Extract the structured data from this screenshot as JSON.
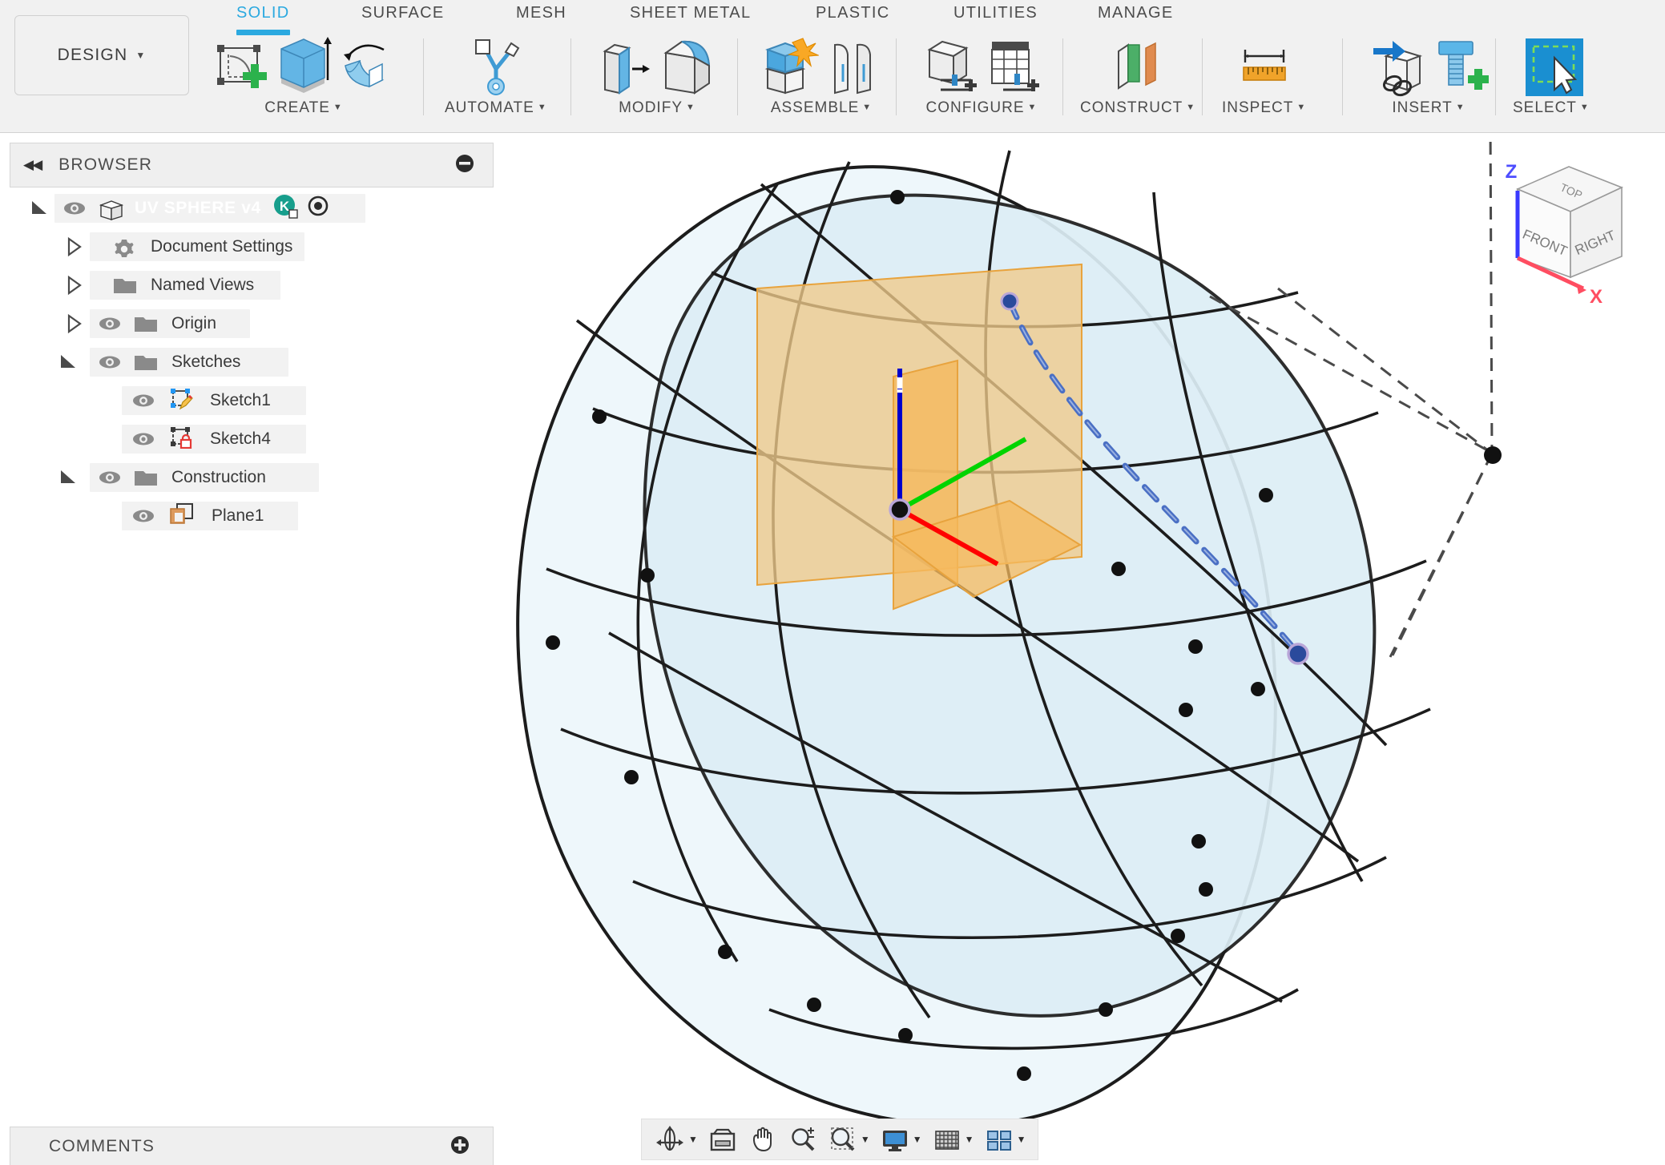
{
  "app": {
    "workspace": "DESIGN",
    "workspace_caret": "▼"
  },
  "ribbon": {
    "tabs": [
      {
        "label": "SOLID",
        "active": true
      },
      {
        "label": "SURFACE",
        "active": false
      },
      {
        "label": "MESH",
        "active": false
      },
      {
        "label": "SHEET METAL",
        "active": false
      },
      {
        "label": "PLASTIC",
        "active": false
      },
      {
        "label": "UTILITIES",
        "active": false
      },
      {
        "label": "MANAGE",
        "active": false
      }
    ],
    "panels": [
      {
        "label": "CREATE",
        "caret": "▼",
        "icons": [
          "create-sketch-icon",
          "extrude-icon",
          "revolve-icon"
        ]
      },
      {
        "label": "AUTOMATE",
        "caret": "▼",
        "icons": [
          "automate-icon"
        ]
      },
      {
        "label": "MODIFY",
        "caret": "▼",
        "icons": [
          "press-pull-icon",
          "fillet-icon"
        ]
      },
      {
        "label": "ASSEMBLE",
        "caret": "▼",
        "icons": [
          "new-component-icon",
          "joint-icon"
        ]
      },
      {
        "label": "CONFIGURE",
        "caret": "▼",
        "icons": [
          "configure-body-icon",
          "configure-table-icon"
        ]
      },
      {
        "label": "CONSTRUCT",
        "caret": "▼",
        "icons": [
          "offset-plane-icon"
        ]
      },
      {
        "label": "INSPECT",
        "caret": "▼",
        "icons": [
          "measure-icon"
        ]
      },
      {
        "label": "INSERT",
        "caret": "▼",
        "icons": [
          "insert-derive-icon",
          "insert-mcmaster-icon"
        ]
      },
      {
        "label": "SELECT",
        "caret": "▼",
        "icons": [
          "select-window-icon"
        ]
      }
    ]
  },
  "browser": {
    "title": "BROWSER",
    "collapse_icon": "collapse-left-icon",
    "minimize_icon": "minus-circle-icon",
    "tree": [
      {
        "label": "UV SPHERE v4",
        "indent": 0,
        "arrow": "expanded",
        "eye": true,
        "icon": "component-cube-icon",
        "selected": true,
        "badge": "K",
        "target": true
      },
      {
        "label": "Document Settings",
        "indent": 1,
        "arrow": "collapsed",
        "eye": false,
        "icon": "gear-icon"
      },
      {
        "label": "Named Views",
        "indent": 1,
        "arrow": "collapsed",
        "eye": false,
        "icon": "folder-icon"
      },
      {
        "label": "Origin",
        "indent": 1,
        "arrow": "collapsed",
        "eye": true,
        "icon": "folder-icon"
      },
      {
        "label": "Sketches",
        "indent": 1,
        "arrow": "expanded",
        "eye": true,
        "icon": "folder-icon"
      },
      {
        "label": "Sketch1",
        "indent": 2,
        "arrow": "none",
        "eye": true,
        "icon": "sketch-pencil-icon"
      },
      {
        "label": "Sketch4",
        "indent": 2,
        "arrow": "none",
        "eye": true,
        "icon": "sketch-locked-icon"
      },
      {
        "label": "Construction",
        "indent": 1,
        "arrow": "expanded",
        "eye": true,
        "icon": "folder-icon"
      },
      {
        "label": "Plane1",
        "indent": 2,
        "arrow": "none",
        "eye": true,
        "icon": "plane-icon"
      }
    ]
  },
  "comments": {
    "title": "COMMENTS",
    "add_icon": "plus-circle-icon"
  },
  "viewcube": {
    "faces": {
      "top": "TOP",
      "front": "FRONT",
      "right": "RIGHT"
    },
    "axes": {
      "z": "Z",
      "x": "X"
    },
    "z_color": "#3333ff",
    "x_color": "#ff3344"
  },
  "navbar": {
    "items": [
      {
        "name": "orbit-icon",
        "caret": true
      },
      {
        "name": "pan-view-icon",
        "caret": false
      },
      {
        "name": "pan-hand-icon",
        "caret": false
      },
      {
        "name": "zoom-icon",
        "caret": false
      },
      {
        "name": "zoom-window-icon",
        "caret": true
      },
      {
        "name": "display-settings-icon",
        "caret": true
      },
      {
        "name": "grid-snaps-icon",
        "caret": true
      },
      {
        "name": "viewports-icon",
        "caret": true
      }
    ]
  },
  "viewport": {
    "model_name": "UV Sphere",
    "sphere_fill": "#e8f4f9",
    "sphere_fill_alt": "#d8eef5",
    "wire_color": "#1c1c1c",
    "plane_fill": "#f0cb8a",
    "plane_fill_alt": "#f5b95e",
    "plane_edge": "#e8a33d",
    "axis_x_color": "#ff0000",
    "axis_y_color": "#00d400",
    "axis_z_color": "#0000cc",
    "spline_color": "#4a6fc4",
    "construction_color": "#4a4a4a"
  }
}
